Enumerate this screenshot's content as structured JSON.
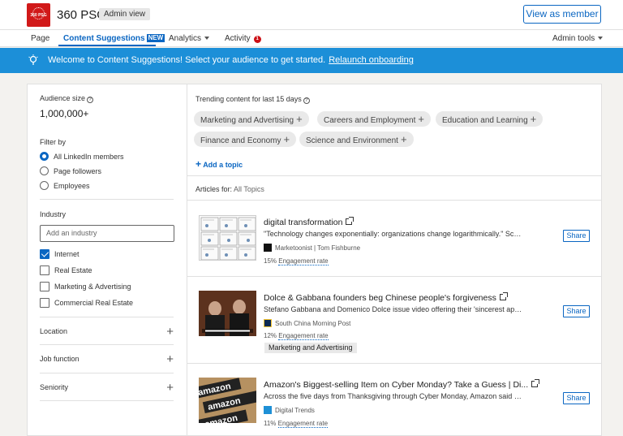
{
  "header": {
    "logo_text": "360 PSG",
    "company_name": "360 PSG",
    "admin_badge": "Admin view",
    "view_as_member": "View as member"
  },
  "nav": {
    "page": "Page",
    "content_suggestions": "Content Suggestions",
    "new_badge": "NEW",
    "analytics": "Analytics",
    "activity": "Activity",
    "activity_count": "1",
    "admin_tools": "Admin tools"
  },
  "banner": {
    "text": "Welcome to Content Suggestions! Select your audience to get started.",
    "link": "Relaunch onboarding"
  },
  "audience": {
    "label": "Audience size",
    "size": "1,000,000+"
  },
  "filter": {
    "label": "Filter by",
    "options": [
      "All LinkedIn members",
      "Page followers",
      "Employees"
    ],
    "selected": 0
  },
  "industry": {
    "label": "Industry",
    "placeholder": "Add an industry",
    "options": [
      {
        "label": "Internet",
        "checked": true
      },
      {
        "label": "Real Estate",
        "checked": false
      },
      {
        "label": "Marketing & Advertising",
        "checked": false
      },
      {
        "label": "Commercial Real Estate",
        "checked": false
      }
    ]
  },
  "collapsibles": [
    "Location",
    "Job function",
    "Seniority"
  ],
  "trending": {
    "title": "Trending content for last 15 days",
    "topics": [
      "Marketing and Advertising",
      "Careers and Employment",
      "Education and Learning",
      "Finance and Economy",
      "Science and Environment"
    ],
    "add_topic": "Add a topic"
  },
  "articles_for": {
    "label": "Articles for:",
    "value": "All Topics"
  },
  "articles": [
    {
      "title": "digital transformation",
      "desc": "\"Technology changes exponentially: organizations change logarithmically.\" Scot...",
      "source": "Marketoonist | Tom Fishburne",
      "engagement": "15%",
      "engagement_label": "Engagement rate",
      "tag": "",
      "share": "Share"
    },
    {
      "title": "Dolce & Gabbana founders beg Chinese people's forgiveness",
      "desc": "Stefano Gabbana and Domenico Dolce issue video offering their 'sincerest apol...",
      "source": "South China Morning Post",
      "engagement": "12%",
      "engagement_label": "Engagement rate",
      "tag": "Marketing and Advertising",
      "share": "Share"
    },
    {
      "title": "Amazon's Biggest-selling Item on Cyber Monday? Take a Guess | Di...",
      "desc": "Across the five days from Thanksgiving through Cyber Monday, Amazon said c...",
      "source": "Digital Trends",
      "engagement": "11%",
      "engagement_label": "Engagement rate",
      "tag": "",
      "share": "Share"
    }
  ],
  "thumb_texts": {
    "amazon": "amazon"
  },
  "colors": {
    "accent": "#0a66c2",
    "banner": "#1c8fd8",
    "brand_red": "#d11919"
  }
}
